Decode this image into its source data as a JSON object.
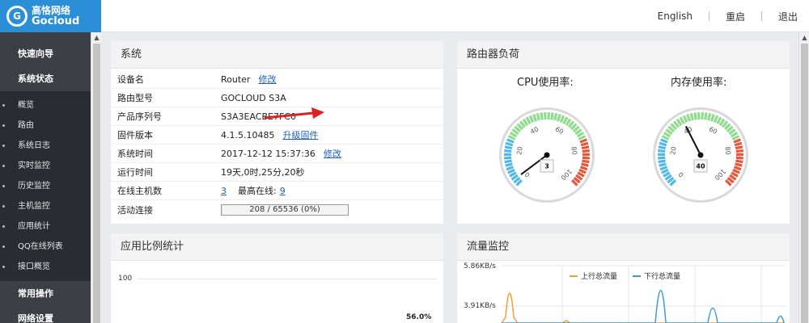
{
  "brand": {
    "logo_mark": "G",
    "name_cn": "高恪网络",
    "name_en": "Gocloud"
  },
  "topnav": {
    "english": "English",
    "reboot": "重启",
    "logout": "退出"
  },
  "sidebar": {
    "quick": "快速向导",
    "status": "系统状态",
    "items": [
      "概览",
      "路由",
      "系统日志",
      "实时监控",
      "历史监控",
      "主机监控",
      "应用统计",
      "QQ在线列表",
      "接口概览"
    ],
    "common": "常用操作",
    "network": "网络设置"
  },
  "system": {
    "title": "系统",
    "rows": {
      "device_name": {
        "label": "设备名",
        "value": "Router",
        "action": "修改"
      },
      "model": {
        "label": "路由型号",
        "value": "GOCLOUD S3A"
      },
      "serial": {
        "label": "产品序列号",
        "value": "S3A3EACBE7FC0"
      },
      "firmware": {
        "label": "固件版本",
        "value": "4.1.5.10485",
        "action": "升级固件"
      },
      "time": {
        "label": "系统时间",
        "value": "2017-12-12 15:37:36",
        "action": "修改"
      },
      "uptime": {
        "label": "运行时间",
        "value": "19天,0时,25分,20秒"
      },
      "online": {
        "label": "在线主机数",
        "value": "3",
        "max_label": "最高在线:",
        "max_value": "9"
      },
      "connections": {
        "label": "活动连接",
        "value": "208 / 65536 (0%)",
        "fraction": 0.003
      }
    }
  },
  "load": {
    "title": "路由器负荷",
    "cpu": {
      "title": "CPU使用率:",
      "value": 3,
      "display": "3"
    },
    "mem": {
      "title": "内存使用率:",
      "value": 40,
      "display": "40"
    },
    "ticks": [
      "0",
      "20",
      "40",
      "60",
      "80",
      "100"
    ]
  },
  "app": {
    "title": "应用比例统计",
    "y_tick": "100",
    "pct": "56.0%"
  },
  "traffic": {
    "title": "流量监控",
    "y_ticks": [
      "5.86KB/s",
      "3.91KB/s"
    ],
    "legend_up": "上行总流量",
    "legend_down": "下行总流量",
    "color_up": "#f5a033",
    "color_down": "#3b9ddd"
  },
  "colors": {
    "brand": "#2a8fd6",
    "sidebar": "#3c3f45",
    "gauge_green": "#8fdc8f",
    "gauge_blue": "#4fb8e8",
    "gauge_red": "#e8553a"
  }
}
